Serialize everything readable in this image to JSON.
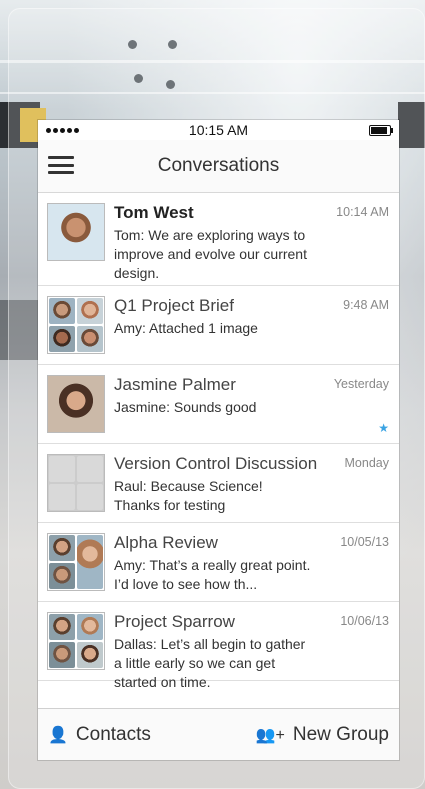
{
  "status_bar": {
    "time": "10:15 AM"
  },
  "nav": {
    "title": "Conversations",
    "menu_icon": "hamburger-icon"
  },
  "conversations": [
    {
      "title": "Tom West",
      "bold": true,
      "date": "10:14 AM",
      "preview": "Tom: We are exploring ways to improve and evolve our current design.",
      "avatar": "single",
      "colors": [
        "#8a5a3c"
      ]
    },
    {
      "title": "Q1 Project Brief",
      "bold": false,
      "date": "9:48 AM",
      "preview": "Amy: Attached 1 image",
      "avatar": "grid",
      "colors": [
        "#9b6b4c",
        "#c58d6d",
        "#a46a4e",
        "#b67a5f"
      ]
    },
    {
      "title": "Jasmine Palmer",
      "bold": false,
      "date": "Yesterday",
      "preview": "Jasmine: Sounds good",
      "avatar": "single",
      "colors": [
        "#6e4a36"
      ],
      "pinned": true
    },
    {
      "title": "Version Control Discussion",
      "bold": false,
      "date": "Monday",
      "preview": "Raul: Because Science! Thanks for testing",
      "avatar": "blank",
      "colors": []
    },
    {
      "title": "Alpha Review",
      "bold": false,
      "date": "10/05/13",
      "preview": "Amy: That’s a really great point. I’d love to see how th...",
      "avatar": "grid",
      "colors": [
        "#8f6448",
        "#c99a7a",
        "#7a5a45",
        "#c99a7a"
      ]
    },
    {
      "title": "Project Sparrow",
      "bold": false,
      "date": "10/06/13",
      "preview": "Dallas: Let’s all begin to gather a little early so we can get started on time.",
      "avatar": "grid",
      "colors": [
        "#8f6448",
        "#c99a7a",
        "#7a5a45",
        "#b88a6d"
      ]
    }
  ],
  "bottom_bar": {
    "contacts_label": "Contacts",
    "new_group_label": "New Group"
  }
}
